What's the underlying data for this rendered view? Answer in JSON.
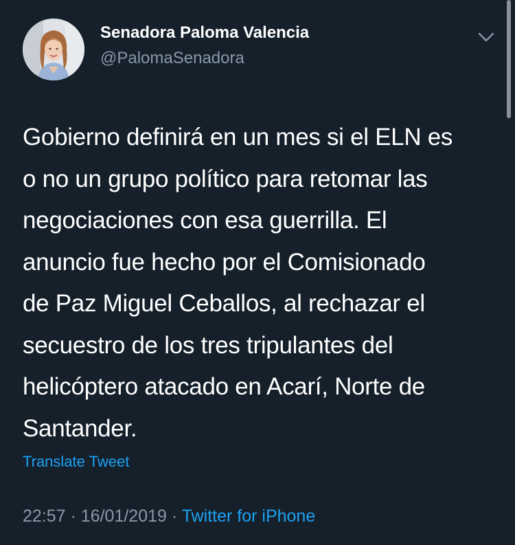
{
  "author": {
    "display_name": "Senadora Paloma Valencia",
    "handle": "@PalomaSenadora",
    "avatar_icon": "profile-photo"
  },
  "menu": {
    "icon": "chevron-down-icon"
  },
  "tweet": {
    "lines": [
      "Gobierno definirá en un mes si el ELN es",
      "o no un grupo político para retomar las",
      "negociaciones con esa guerrilla. El",
      "anuncio fue hecho por el Comisionado",
      "de Paz Miguel Ceballos, al rechazar el",
      "secuestro de los tres tripulantes del",
      "helicóptero atacado en Acarí, Norte de",
      "Santander."
    ],
    "translate_label": "Translate Tweet",
    "time": "22:57",
    "separator": "·",
    "date": "16/01/2019",
    "source": "Twitter for iPhone"
  },
  "colors": {
    "background": "#15202b",
    "text": "#ffffff",
    "secondary": "#8899a6",
    "accent": "#1da1f2"
  }
}
